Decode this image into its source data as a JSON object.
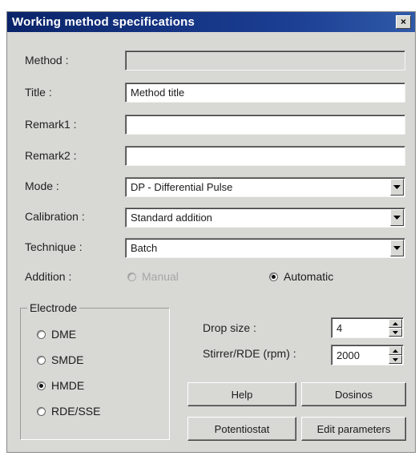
{
  "window": {
    "title": "Working method specifications",
    "close_label": "×"
  },
  "fields": {
    "method": {
      "label": "Method :",
      "value": ""
    },
    "title": {
      "label": "Title :",
      "value": "Method title"
    },
    "remark1": {
      "label": "Remark1 :",
      "value": ""
    },
    "remark2": {
      "label": "Remark2 :",
      "value": ""
    },
    "mode": {
      "label": "Mode :",
      "value": "DP - Differential Pulse"
    },
    "calibration": {
      "label": "Calibration :",
      "value": "Standard addition"
    },
    "technique": {
      "label": "Technique :",
      "value": "Batch"
    }
  },
  "addition": {
    "label": "Addition :",
    "manual": {
      "label": "Manual",
      "selected": false,
      "enabled": false
    },
    "automatic": {
      "label": "Automatic",
      "selected": true,
      "enabled": true
    }
  },
  "electrode": {
    "legend": "Electrode",
    "options": [
      {
        "label": "DME",
        "selected": false
      },
      {
        "label": "SMDE",
        "selected": false
      },
      {
        "label": "HMDE",
        "selected": true
      },
      {
        "label": "RDE/SSE",
        "selected": false
      }
    ]
  },
  "drop_size": {
    "label": "Drop size :",
    "value": "4"
  },
  "stirrer": {
    "label": "Stirrer/RDE (rpm) :",
    "value": "2000"
  },
  "buttons": {
    "help": "Help",
    "dosinos": "Dosinos",
    "potentiostat": "Potentiostat",
    "edit_parameters": "Edit parameters"
  }
}
